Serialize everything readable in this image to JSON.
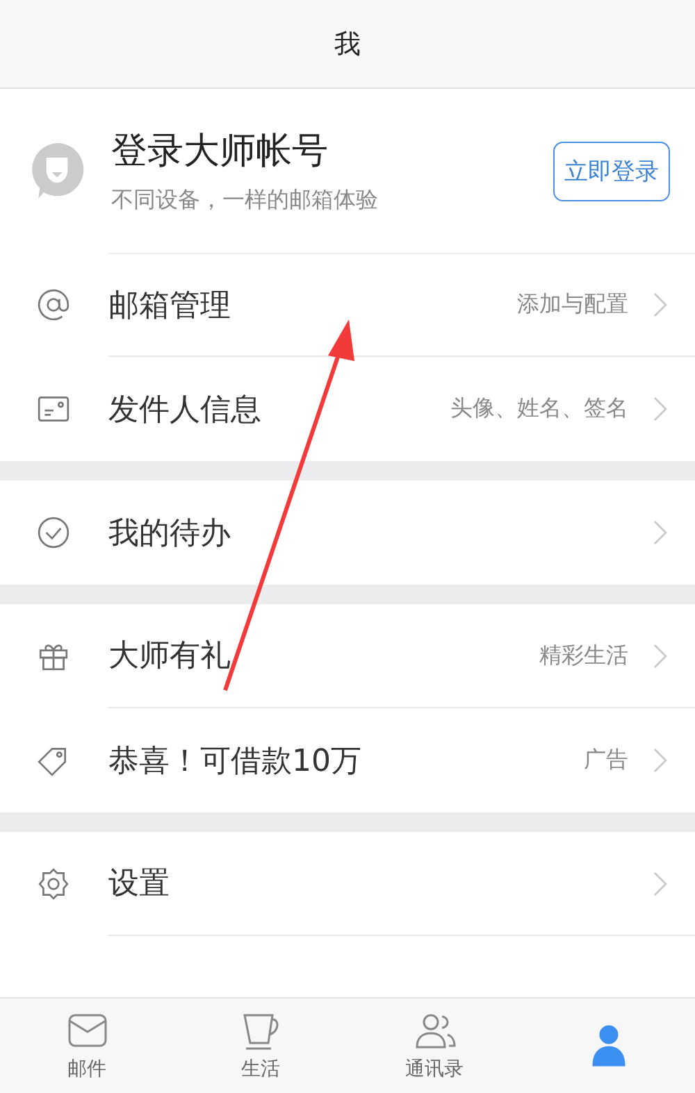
{
  "header": {
    "title": "我"
  },
  "profile": {
    "name": "登录大师帐号",
    "subtitle": "不同设备，一样的邮箱体验",
    "button": "立即登录"
  },
  "sections": [
    {
      "items": [
        {
          "label": "邮箱管理",
          "hint": "添加与配置"
        },
        {
          "label": "发件人信息",
          "hint": "头像、姓名、签名"
        }
      ]
    },
    {
      "items": [
        {
          "label": "我的待办"
        }
      ]
    },
    {
      "items": [
        {
          "label": "大师有礼",
          "hint": "精彩生活"
        },
        {
          "label": "恭喜！可借款10万",
          "hint": "广告"
        }
      ]
    },
    {
      "items": [
        {
          "label": "设置"
        }
      ]
    }
  ],
  "tabs": [
    {
      "label": "邮件",
      "selected": false
    },
    {
      "label": "生活",
      "selected": false
    },
    {
      "label": "通讯录",
      "selected": false
    },
    {
      "selected": true
    }
  ],
  "annotation": {
    "kind": "arrow"
  }
}
